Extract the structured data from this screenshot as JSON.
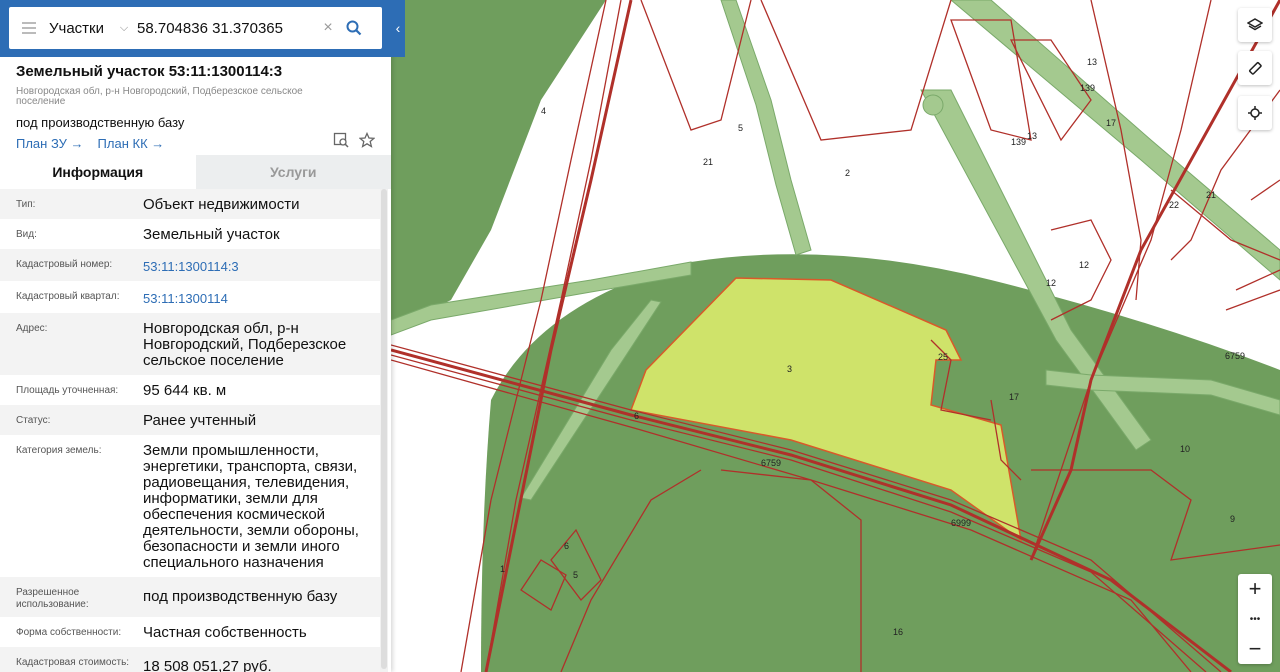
{
  "search": {
    "type_label": "Участки",
    "value": "58.704836 31.370365"
  },
  "parcel": {
    "title": "Земельный участок 53:11:1300114:3",
    "address_short": "Новгородская обл, р-н Новгородский, Подберезское сельское поселение",
    "use": "под производственную базу",
    "link_plan_zu": "План ЗУ",
    "link_plan_kk": "План КК",
    "arrow": "→"
  },
  "tabs": [
    {
      "label": "Информация",
      "active": true
    },
    {
      "label": "Услуги",
      "active": false
    }
  ],
  "info": [
    {
      "label": "Тип:",
      "value": "Объект недвижимости"
    },
    {
      "label": "Вид:",
      "value": "Земельный участок"
    },
    {
      "label": "Кадастровый номер:",
      "value": "53:11:1300114:3",
      "link": true
    },
    {
      "label": "Кадастровый квартал:",
      "value": "53:11:1300114",
      "link": true
    },
    {
      "label": "Адрес:",
      "value": "Новгородская обл, р-н Новгородский, Подберезское сельское поселение"
    },
    {
      "label": "Площадь уточненная:",
      "value": "95 644 кв. м"
    },
    {
      "label": "Статус:",
      "value": "Ранее учтенный"
    },
    {
      "label": "Категория земель:",
      "value": "Земли промышленности, энергетики, транспорта, связи, радиовещания, телевидения, информатики, земли для обеспечения космической деятельности, земли обороны, безопасности и земли иного специального назначения"
    },
    {
      "label": "Разрешенное использование:",
      "value": "под производственную базу"
    },
    {
      "label": "Форма собственности:",
      "value": "Частная собственность"
    },
    {
      "label": "Кадастровая стоимость:",
      "value": "18 508 051,27 руб."
    }
  ],
  "map": {
    "labels": [
      {
        "text": "4"
      },
      {
        "text": "5"
      },
      {
        "text": "2"
      },
      {
        "text": "13"
      },
      {
        "text": "139"
      },
      {
        "text": "139"
      },
      {
        "text": "13"
      },
      {
        "text": "17"
      },
      {
        "text": "22"
      },
      {
        "text": "21"
      },
      {
        "text": "12"
      },
      {
        "text": "12"
      },
      {
        "text": "6759"
      },
      {
        "text": "25"
      },
      {
        "text": "3"
      },
      {
        "text": "17"
      },
      {
        "text": "10"
      },
      {
        "text": "6"
      },
      {
        "text": "6759"
      },
      {
        "text": "6999"
      },
      {
        "text": "9"
      },
      {
        "text": "6"
      },
      {
        "text": "5"
      },
      {
        "text": "1"
      },
      {
        "text": "16"
      },
      {
        "text": "21"
      }
    ],
    "colors": {
      "forest": "#6f9e5d",
      "forest_light": "#a4c98f",
      "parcel_highlight": "#cfe36a",
      "boundary": "#b0302a"
    }
  },
  "controls": {
    "layers": "layers-icon",
    "ruler": "ruler-icon",
    "locate": "locate-icon",
    "zoom_in": "+",
    "more": "•••",
    "zoom_out": "−"
  }
}
